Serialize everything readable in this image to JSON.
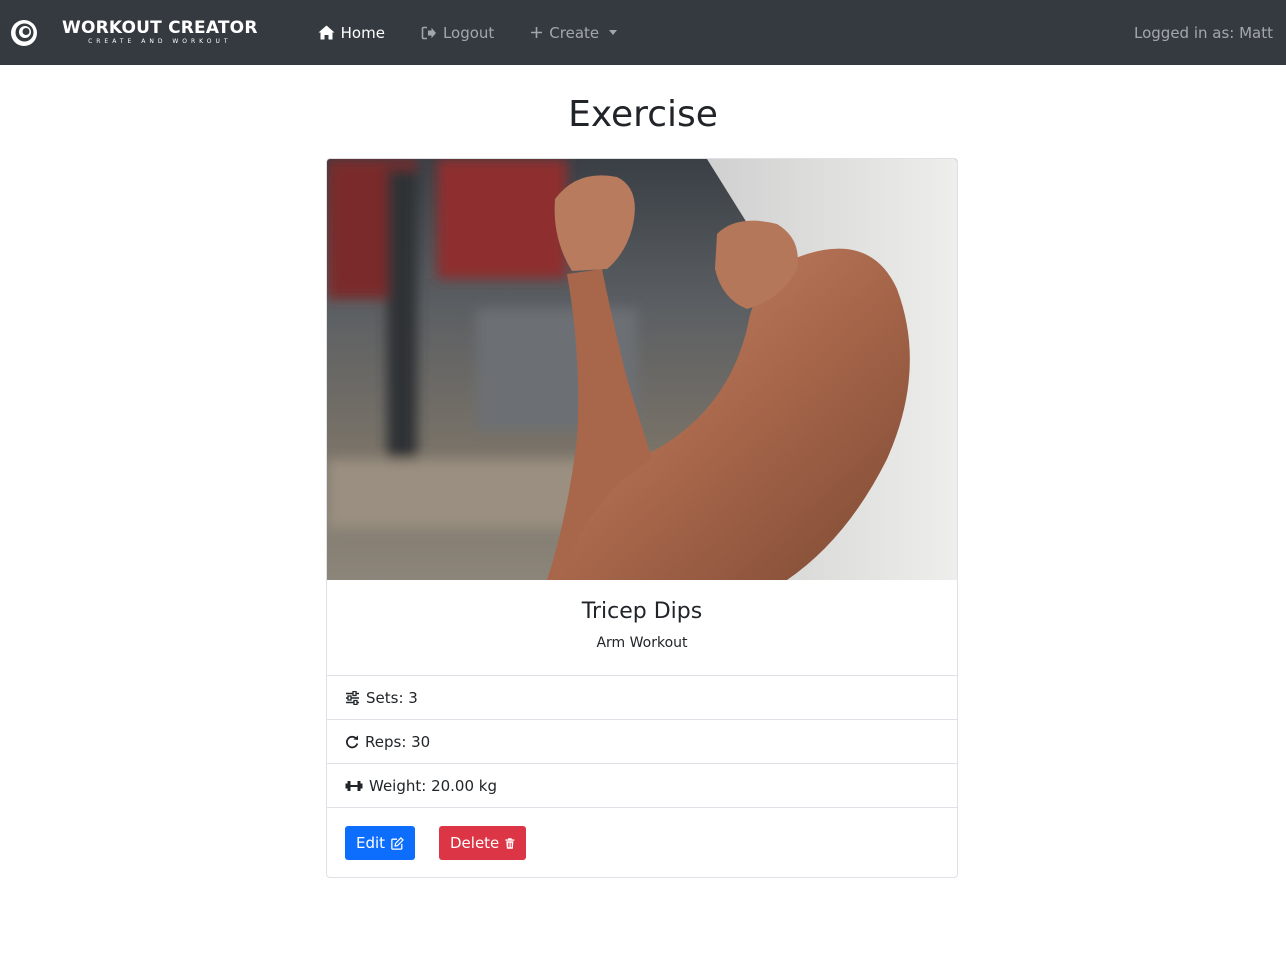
{
  "navbar": {
    "brand_title": "WORKOUT CREATOR",
    "brand_subtitle": "CREATE AND WORKOUT",
    "links": [
      {
        "label": "Home",
        "icon": "home-icon",
        "active": true
      },
      {
        "label": "Logout",
        "icon": "logout-icon",
        "active": false
      },
      {
        "label": "Create",
        "icon": "plus-icon",
        "active": false,
        "dropdown": true
      }
    ],
    "user_text": "Logged in as: Matt"
  },
  "page": {
    "title": "Exercise"
  },
  "exercise": {
    "image_alt": "arm-flex-photo",
    "name": "Tricep Dips",
    "workout": "Arm Workout",
    "sets_label": "Sets: 3",
    "reps_label": "Reps: 30",
    "weight_label": "Weight: 20.00 kg"
  },
  "actions": {
    "edit_label": "Edit",
    "delete_label": "Delete"
  },
  "colors": {
    "navbar_bg": "#343a40",
    "primary": "#0d6efd",
    "danger": "#dc3545"
  }
}
